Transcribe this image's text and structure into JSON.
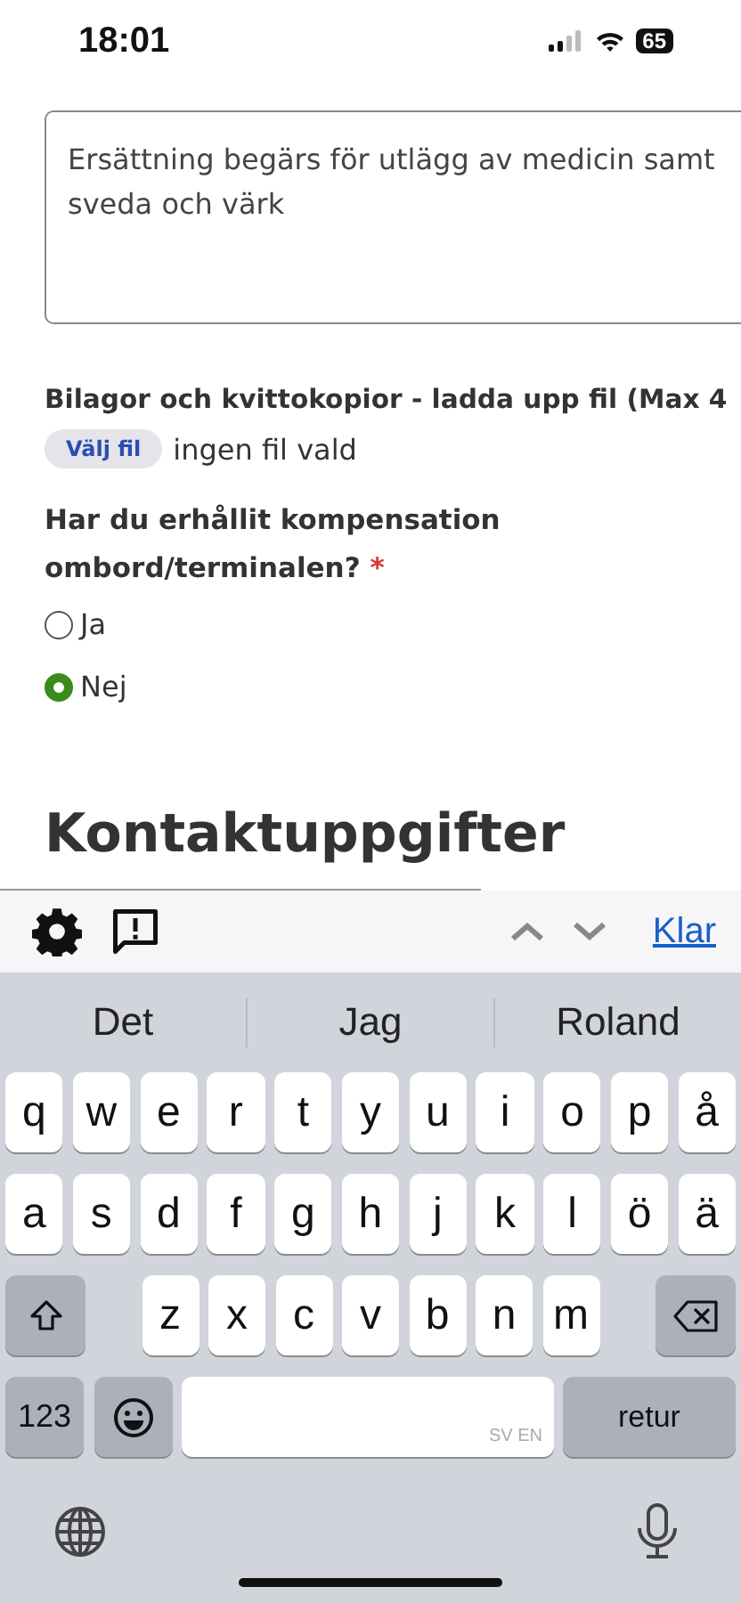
{
  "status_bar": {
    "time": "18:01",
    "battery": "65"
  },
  "form": {
    "claim_text": "Ersättning begärs för utlägg av medicin samt sveda och värk",
    "attachments_label": "Bilagor och kvittokopior - ladda upp fil (Max 4",
    "file_button": "Välj fil",
    "file_status": "ingen fil vald",
    "question": "Har du erhållit kompensation ombord/terminalen?",
    "required_mark": "*",
    "options": [
      {
        "label": "Ja",
        "selected": false
      },
      {
        "label": "Nej",
        "selected": true
      }
    ],
    "section_heading": "Kontaktuppgifter"
  },
  "keyboard_toolbar": {
    "done": "Klar"
  },
  "suggestions": [
    "Det",
    "Jag",
    "Roland"
  ],
  "keyboard": {
    "row_1": [
      "q",
      "w",
      "e",
      "r",
      "t",
      "y",
      "u",
      "i",
      "o",
      "p",
      "å"
    ],
    "row_2": [
      "a",
      "s",
      "d",
      "f",
      "g",
      "h",
      "j",
      "k",
      "l",
      "ö",
      "ä"
    ],
    "row_3": [
      "z",
      "x",
      "c",
      "v",
      "b",
      "n",
      "m"
    ],
    "numbers_key": "123",
    "space_languages": "SV EN",
    "return_key": "retur"
  }
}
